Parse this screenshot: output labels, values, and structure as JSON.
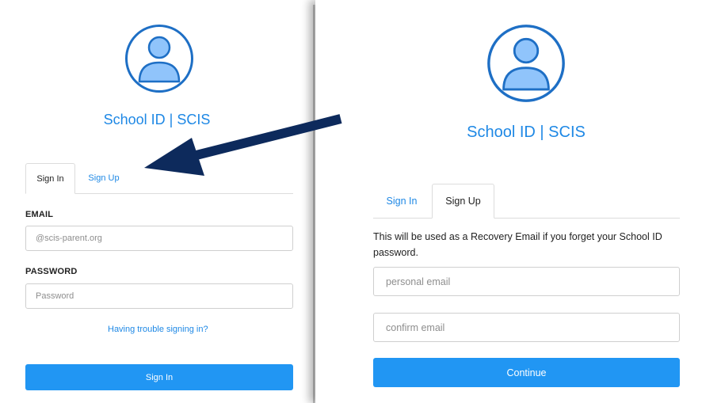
{
  "left": {
    "brand_title": "School ID | SCIS",
    "tabs": [
      {
        "label": "Sign In",
        "active": true
      },
      {
        "label": "Sign Up",
        "active": false
      }
    ],
    "email_label": "EMAIL",
    "email_placeholder": "@scis-parent.org",
    "password_label": "PASSWORD",
    "password_placeholder": "Password",
    "trouble_link": "Having trouble signing in?",
    "signin_button": "Sign In"
  },
  "right": {
    "brand_title": "School ID | SCIS",
    "tabs": [
      {
        "label": "Sign In",
        "active": false
      },
      {
        "label": "Sign Up",
        "active": true
      }
    ],
    "description": "This will be used as a Recovery Email if you forget your School ID password.",
    "personal_email_placeholder": "personal email",
    "confirm_email_placeholder": "confirm email",
    "continue_button": "Continue"
  },
  "colors": {
    "accent": "#1e88e5",
    "button": "#2196f3",
    "avatar_fill": "#90c4fb",
    "avatar_stroke": "#1e6fc5",
    "arrow": "#0d2a5c"
  },
  "icons": {
    "avatar": "user-avatar-icon",
    "arrow": "pointer-arrow-icon"
  }
}
